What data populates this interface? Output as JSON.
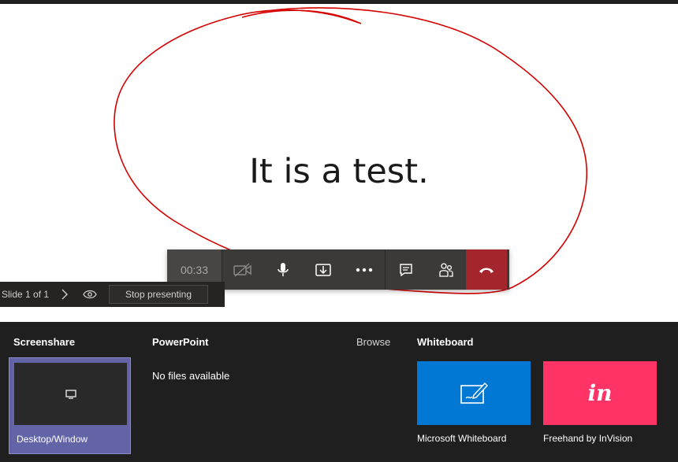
{
  "slide": {
    "text": "It is a test."
  },
  "call_controls": {
    "timer": "00:33",
    "buttons": [
      {
        "name": "camera-off-button",
        "icon": "video-off-icon"
      },
      {
        "name": "microphone-button",
        "icon": "microphone-icon"
      },
      {
        "name": "share-tray-button",
        "icon": "share-icon"
      },
      {
        "name": "more-actions-button",
        "icon": "more-icon"
      },
      {
        "name": "chat-button",
        "icon": "chat-icon"
      },
      {
        "name": "participants-button",
        "icon": "people-icon"
      },
      {
        "name": "hang-up-button",
        "icon": "phone-hangup-icon"
      }
    ],
    "hangup_color": "#a4262c"
  },
  "slide_nav": {
    "count": "Slide 1 of 1",
    "stop_label": "Stop presenting"
  },
  "share_tray": {
    "screenshare": {
      "heading": "Screenshare",
      "option_label": "Desktop/Window"
    },
    "powerpoint": {
      "heading": "PowerPoint",
      "empty_text": "No files available",
      "browse_label": "Browse"
    },
    "whiteboard": {
      "heading": "Whiteboard",
      "options": [
        {
          "label": "Microsoft Whiteboard",
          "color": "#0078d4",
          "icon": "whiteboard-pen-icon"
        },
        {
          "label": "Freehand by InVision",
          "color": "#ff3366",
          "logo": "in"
        }
      ]
    }
  }
}
